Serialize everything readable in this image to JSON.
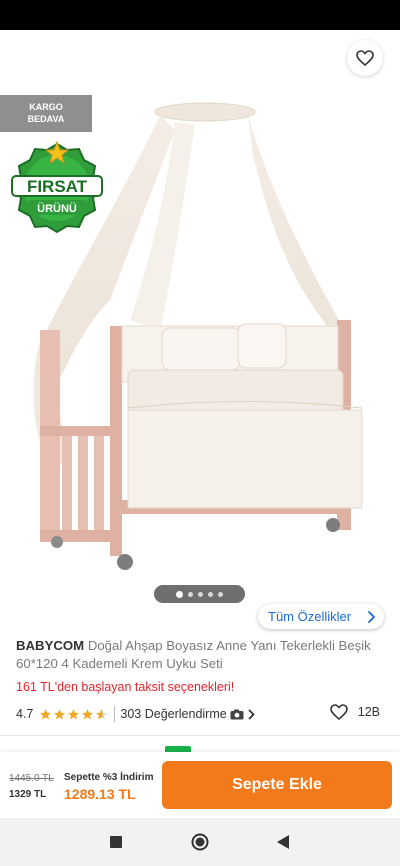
{
  "hero": {
    "cargo_badge": [
      "KARGO",
      "BEDAVA"
    ],
    "firsat_badge": [
      "FIRSAT",
      "ÜRÜNÜ"
    ],
    "pager": {
      "count": 5,
      "active_index": 0
    }
  },
  "features_button": {
    "label": "Tüm Özellikler"
  },
  "product": {
    "brand": "BABYCOM",
    "name": "Doğal Ahşap Boyasız Anne Yanı Tekerlekli Beşik 60*120 4 Kademeli Krem Uyku Seti",
    "installment_text": "161 TL'den başlayan taksit seçenekleri!",
    "rating": "4.7",
    "rating_stars": 4.7,
    "reviews_text": "303 Değerlendirme",
    "likes": "12B"
  },
  "bottom_bar": {
    "old_price": "1445.0 TL",
    "price": "1329 TL",
    "discount_label": "Sepette %3 İndirim",
    "discounted_price": "1289.13 TL",
    "cart_button": "Sepete Ekle"
  },
  "colors": {
    "accent": "#f27a1a",
    "link": "#1e6bd6",
    "installment": "#e0262e",
    "star": "#f5a623",
    "firsat_green": "#2f9e3a"
  },
  "icons": {
    "back": "arrow-left-icon",
    "share": "share-icon",
    "favorite": "heart-icon",
    "features": "chevron-right-icon",
    "reviews": "camera-icon",
    "likes": "heart-outline-icon",
    "nav_recents": "square-icon",
    "nav_home": "circle-icon",
    "nav_back": "triangle-back-icon"
  }
}
